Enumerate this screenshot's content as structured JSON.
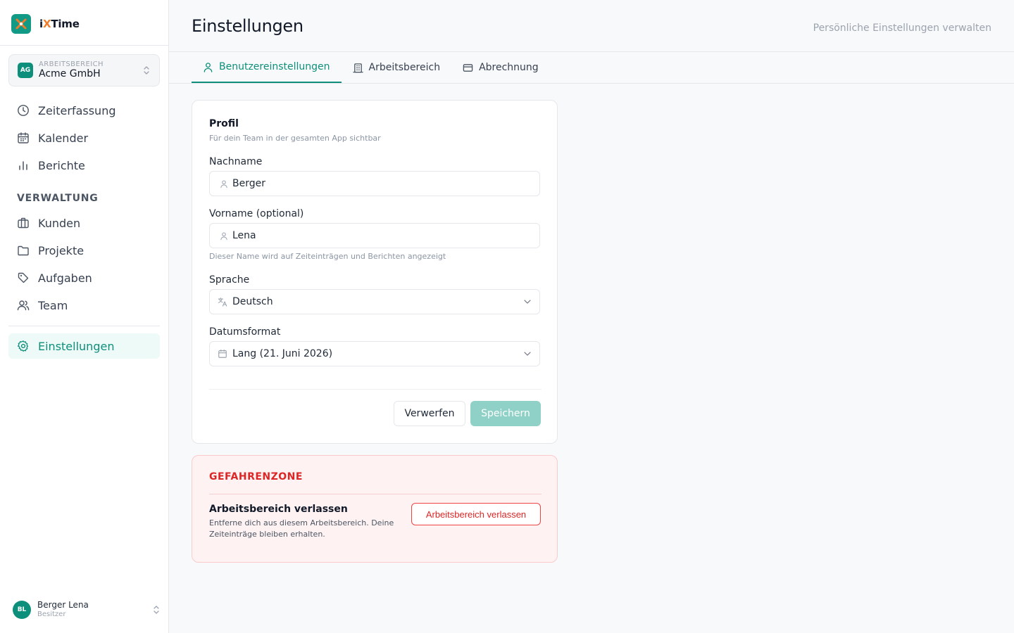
{
  "app": {
    "name_prefix": "i",
    "name_accent": "X",
    "name_suffix": "Time"
  },
  "workspace": {
    "label": "ARBEITSBEREICH",
    "name": "Acme GmbH",
    "badge": "AG"
  },
  "nav": {
    "main": [
      {
        "label": "Zeiterfassung",
        "icon": "clock-icon"
      },
      {
        "label": "Kalender",
        "icon": "calendar-icon"
      },
      {
        "label": "Berichte",
        "icon": "bar-chart-icon"
      }
    ],
    "section_title": "VERWALTUNG",
    "admin": [
      {
        "label": "Kunden",
        "icon": "briefcase-icon"
      },
      {
        "label": "Projekte",
        "icon": "folder-icon"
      },
      {
        "label": "Aufgaben",
        "icon": "tag-icon"
      },
      {
        "label": "Team",
        "icon": "users-icon"
      }
    ],
    "settings": {
      "label": "Einstellungen",
      "icon": "gear-icon",
      "active": true
    }
  },
  "user": {
    "name": "Berger Lena",
    "role": "Besitzer",
    "initials": "BL"
  },
  "header": {
    "title": "Einstellungen",
    "subtitle": "Persönliche Einstellungen verwalten"
  },
  "tabs": [
    {
      "label": "Benutzereinstellungen",
      "icon": "user-icon",
      "active": true
    },
    {
      "label": "Arbeitsbereich",
      "icon": "building-icon",
      "active": false
    },
    {
      "label": "Abrechnung",
      "icon": "credit-card-icon",
      "active": false
    }
  ],
  "profile": {
    "title": "Profil",
    "description": "Für dein Team in der gesamten App sichtbar",
    "last_name_label": "Nachname",
    "last_name_value": "Berger",
    "first_name_label": "Vorname (optional)",
    "first_name_value": "Lena",
    "name_hint": "Dieser Name wird auf Zeiteinträgen und Berichten angezeigt",
    "language_label": "Sprache",
    "language_value": "Deutsch",
    "date_format_label": "Datumsformat",
    "date_format_value": "Lang (21. Juni 2026)",
    "discard_label": "Verwerfen",
    "save_label": "Speichern"
  },
  "danger_zone": {
    "title": "GEFAHRENZONE",
    "heading": "Arbeitsbereich verlassen",
    "text": "Entferne dich aus diesem Arbeitsbereich. Deine Zeiteinträge bleiben erhalten.",
    "button_label": "Arbeitsbereich verlassen"
  },
  "colors": {
    "accent": "#0e8f7b",
    "accent_light": "#8fd1c6",
    "danger": "#dc2626",
    "brand_orange": "#f07c2a"
  }
}
